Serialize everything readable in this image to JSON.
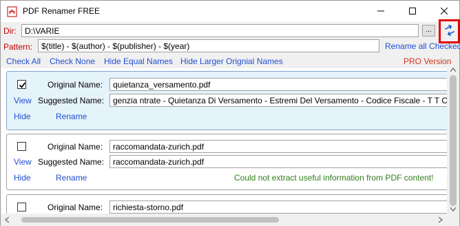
{
  "window": {
    "title": "PDF Renamer FREE"
  },
  "dir": {
    "label": "Dir:",
    "value": "D:\\VARIE",
    "browse_label": "..."
  },
  "pattern": {
    "label": "Pattern:",
    "value": "$(title) - $(author) - $(publisher) - $(year)",
    "rename_all_label": "Rename all Checked"
  },
  "toolbar": {
    "check_all": "Check All",
    "check_none": "Check None",
    "hide_equal": "Hide Equal Names",
    "hide_larger": "Hide Larger Orignial Names",
    "pro_version": "PRO Version"
  },
  "labels": {
    "original_name": "Original Name:",
    "suggested_name": "Suggested Name:",
    "view": "View",
    "hide": "Hide",
    "rename": "Rename"
  },
  "items": [
    {
      "checked": true,
      "original": "quietanza_versamento.pdf",
      "suggested": "genzia ntrate - Quietanza Di Versamento - Estremi Del Versamento - Codice Fiscale - T T O V",
      "message": ""
    },
    {
      "checked": false,
      "original": "raccomandata-zurich.pdf",
      "suggested": "raccomandata-zurich.pdf",
      "message": "Could not extract useful information from PDF content!"
    },
    {
      "checked": false,
      "original": "richiesta-storno.pdf",
      "suggested": "",
      "message": ""
    }
  ],
  "colors": {
    "label_red": "#c00000",
    "link_blue": "#1f4fd1",
    "status_green": "#2e7d1a",
    "selected_bg": "#e5f3fb",
    "highlight_red": "#e00000"
  },
  "icons": {
    "app": "pdf-app-icon",
    "swap": "swap-arrows-icon",
    "minimize": "minimize-icon",
    "maximize": "maximize-icon",
    "close": "close-icon",
    "checkmark": "checkmark-icon"
  }
}
